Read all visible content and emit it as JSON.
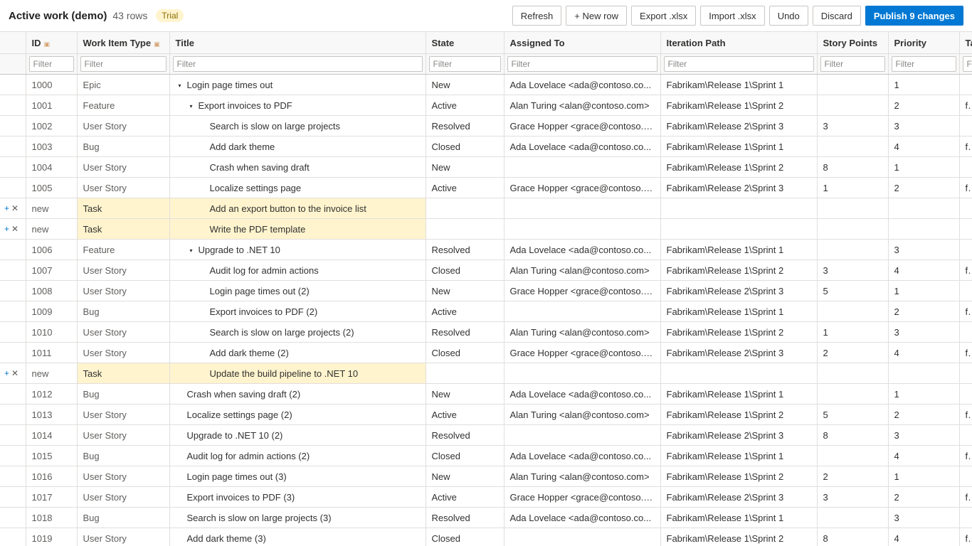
{
  "header": {
    "title": "Active work (demo)",
    "row_count": "43 rows",
    "badge": "Trial"
  },
  "toolbar": {
    "refresh": "Refresh",
    "new_row": "+ New row",
    "export": "Export .xlsx",
    "import": "Import .xlsx",
    "undo": "Undo",
    "discard": "Discard",
    "publish": "Publish 9 changes"
  },
  "columns": [
    {
      "label": "",
      "locked": false
    },
    {
      "label": "ID",
      "locked": true
    },
    {
      "label": "Work Item Type",
      "locked": true
    },
    {
      "label": "Title",
      "locked": false
    },
    {
      "label": "State",
      "locked": false
    },
    {
      "label": "Assigned To",
      "locked": false
    },
    {
      "label": "Iteration Path",
      "locked": false
    },
    {
      "label": "Story Points",
      "locked": false
    },
    {
      "label": "Priority",
      "locked": false
    },
    {
      "label": "Ta",
      "locked": false
    }
  ],
  "filter_placeholder": "Filter",
  "rows": [
    {
      "ctrl": false,
      "id": "1000",
      "type": "Epic",
      "title": "Login page times out",
      "level": 0,
      "caret": true,
      "state": "New",
      "assigned": "Ada Lovelace <ada@contoso.co...",
      "iteration": "Fabrikam\\Release 1\\Sprint 1",
      "points": "",
      "priority": "1",
      "tags": ""
    },
    {
      "ctrl": false,
      "id": "1001",
      "type": "Feature",
      "title": "Export invoices to PDF",
      "level": 1,
      "caret": true,
      "state": "Active",
      "assigned": "Alan Turing <alan@contoso.com>",
      "iteration": "Fabrikam\\Release 1\\Sprint 2",
      "points": "",
      "priority": "2",
      "tags": "fro"
    },
    {
      "ctrl": false,
      "id": "1002",
      "type": "User Story",
      "title": "Search is slow on large projects",
      "level": 2,
      "caret": false,
      "state": "Resolved",
      "assigned": "Grace Hopper <grace@contoso.c...",
      "iteration": "Fabrikam\\Release 2\\Sprint 3",
      "points": "3",
      "priority": "3",
      "tags": ""
    },
    {
      "ctrl": false,
      "id": "1003",
      "type": "Bug",
      "title": "Add dark theme",
      "level": 2,
      "caret": false,
      "state": "Closed",
      "assigned": "Ada Lovelace <ada@contoso.co...",
      "iteration": "Fabrikam\\Release 1\\Sprint 1",
      "points": "",
      "priority": "4",
      "tags": "fro"
    },
    {
      "ctrl": false,
      "id": "1004",
      "type": "User Story",
      "title": "Crash when saving draft",
      "level": 2,
      "caret": false,
      "state": "New",
      "assigned": "",
      "iteration": "Fabrikam\\Release 1\\Sprint 2",
      "points": "8",
      "priority": "1",
      "tags": ""
    },
    {
      "ctrl": false,
      "id": "1005",
      "type": "User Story",
      "title": "Localize settings page",
      "level": 2,
      "caret": false,
      "state": "Active",
      "assigned": "Grace Hopper <grace@contoso.c...",
      "iteration": "Fabrikam\\Release 2\\Sprint 3",
      "points": "1",
      "priority": "2",
      "tags": "fro"
    },
    {
      "ctrl": true,
      "new": true,
      "id": "new",
      "type": "Task",
      "title": "Add an export button to the invoice list",
      "level": 2,
      "caret": false,
      "state": "",
      "assigned": "",
      "iteration": "",
      "points": "",
      "priority": "",
      "tags": ""
    },
    {
      "ctrl": true,
      "new": true,
      "id": "new",
      "type": "Task",
      "title": "Write the PDF template",
      "level": 2,
      "caret": false,
      "state": "",
      "assigned": "",
      "iteration": "",
      "points": "",
      "priority": "",
      "tags": ""
    },
    {
      "ctrl": false,
      "id": "1006",
      "type": "Feature",
      "title": "Upgrade to .NET 10",
      "level": 1,
      "caret": true,
      "state": "Resolved",
      "assigned": "Ada Lovelace <ada@contoso.co...",
      "iteration": "Fabrikam\\Release 1\\Sprint 1",
      "points": "",
      "priority": "3",
      "tags": ""
    },
    {
      "ctrl": false,
      "id": "1007",
      "type": "User Story",
      "title": "Audit log for admin actions",
      "level": 2,
      "caret": false,
      "state": "Closed",
      "assigned": "Alan Turing <alan@contoso.com>",
      "iteration": "Fabrikam\\Release 1\\Sprint 2",
      "points": "3",
      "priority": "4",
      "tags": "fro"
    },
    {
      "ctrl": false,
      "id": "1008",
      "type": "User Story",
      "title": "Login page times out (2)",
      "level": 2,
      "caret": false,
      "state": "New",
      "assigned": "Grace Hopper <grace@contoso.c...",
      "iteration": "Fabrikam\\Release 2\\Sprint 3",
      "points": "5",
      "priority": "1",
      "tags": ""
    },
    {
      "ctrl": false,
      "id": "1009",
      "type": "Bug",
      "title": "Export invoices to PDF (2)",
      "level": 2,
      "caret": false,
      "state": "Active",
      "assigned": "",
      "iteration": "Fabrikam\\Release 1\\Sprint 1",
      "points": "",
      "priority": "2",
      "tags": "fro"
    },
    {
      "ctrl": false,
      "id": "1010",
      "type": "User Story",
      "title": "Search is slow on large projects (2)",
      "level": 2,
      "caret": false,
      "state": "Resolved",
      "assigned": "Alan Turing <alan@contoso.com>",
      "iteration": "Fabrikam\\Release 1\\Sprint 2",
      "points": "1",
      "priority": "3",
      "tags": ""
    },
    {
      "ctrl": false,
      "id": "1011",
      "type": "User Story",
      "title": "Add dark theme (2)",
      "level": 2,
      "caret": false,
      "state": "Closed",
      "assigned": "Grace Hopper <grace@contoso.c...",
      "iteration": "Fabrikam\\Release 2\\Sprint 3",
      "points": "2",
      "priority": "4",
      "tags": "fro"
    },
    {
      "ctrl": true,
      "new": true,
      "id": "new",
      "type": "Task",
      "title": "Update the build pipeline to .NET 10",
      "level": 2,
      "caret": false,
      "state": "",
      "assigned": "",
      "iteration": "",
      "points": "",
      "priority": "",
      "tags": ""
    },
    {
      "ctrl": false,
      "id": "1012",
      "type": "Bug",
      "title": "Crash when saving draft (2)",
      "level": 0,
      "caret": false,
      "state": "New",
      "assigned": "Ada Lovelace <ada@contoso.co...",
      "iteration": "Fabrikam\\Release 1\\Sprint 1",
      "points": "",
      "priority": "1",
      "tags": ""
    },
    {
      "ctrl": false,
      "id": "1013",
      "type": "User Story",
      "title": "Localize settings page (2)",
      "level": 0,
      "caret": false,
      "state": "Active",
      "assigned": "Alan Turing <alan@contoso.com>",
      "iteration": "Fabrikam\\Release 1\\Sprint 2",
      "points": "5",
      "priority": "2",
      "tags": "fro"
    },
    {
      "ctrl": false,
      "id": "1014",
      "type": "User Story",
      "title": "Upgrade to .NET 10 (2)",
      "level": 0,
      "caret": false,
      "state": "Resolved",
      "assigned": "",
      "iteration": "Fabrikam\\Release 2\\Sprint 3",
      "points": "8",
      "priority": "3",
      "tags": ""
    },
    {
      "ctrl": false,
      "id": "1015",
      "type": "Bug",
      "title": "Audit log for admin actions (2)",
      "level": 0,
      "caret": false,
      "state": "Closed",
      "assigned": "Ada Lovelace <ada@contoso.co...",
      "iteration": "Fabrikam\\Release 1\\Sprint 1",
      "points": "",
      "priority": "4",
      "tags": "fro"
    },
    {
      "ctrl": false,
      "id": "1016",
      "type": "User Story",
      "title": "Login page times out (3)",
      "level": 0,
      "caret": false,
      "state": "New",
      "assigned": "Alan Turing <alan@contoso.com>",
      "iteration": "Fabrikam\\Release 1\\Sprint 2",
      "points": "2",
      "priority": "1",
      "tags": ""
    },
    {
      "ctrl": false,
      "id": "1017",
      "type": "User Story",
      "title": "Export invoices to PDF (3)",
      "level": 0,
      "caret": false,
      "state": "Active",
      "assigned": "Grace Hopper <grace@contoso.c...",
      "iteration": "Fabrikam\\Release 2\\Sprint 3",
      "points": "3",
      "priority": "2",
      "tags": "fro"
    },
    {
      "ctrl": false,
      "id": "1018",
      "type": "Bug",
      "title": "Search is slow on large projects (3)",
      "level": 0,
      "caret": false,
      "state": "Resolved",
      "assigned": "Ada Lovelace <ada@contoso.co...",
      "iteration": "Fabrikam\\Release 1\\Sprint 1",
      "points": "",
      "priority": "3",
      "tags": ""
    },
    {
      "ctrl": false,
      "id": "1019",
      "type": "User Story",
      "title": "Add dark theme (3)",
      "level": 0,
      "caret": false,
      "state": "Closed",
      "assigned": "",
      "iteration": "Fabrikam\\Release 1\\Sprint 2",
      "points": "8",
      "priority": "4",
      "tags": "fro"
    }
  ],
  "icons": {
    "lock": "lock-icon",
    "caret": "caret-down-icon",
    "add": "plus-icon",
    "remove": "close-icon"
  },
  "colors": {
    "accent": "#0078d4",
    "new_row_highlight": "#fff4ce",
    "badge_bg": "#fff4ce"
  }
}
